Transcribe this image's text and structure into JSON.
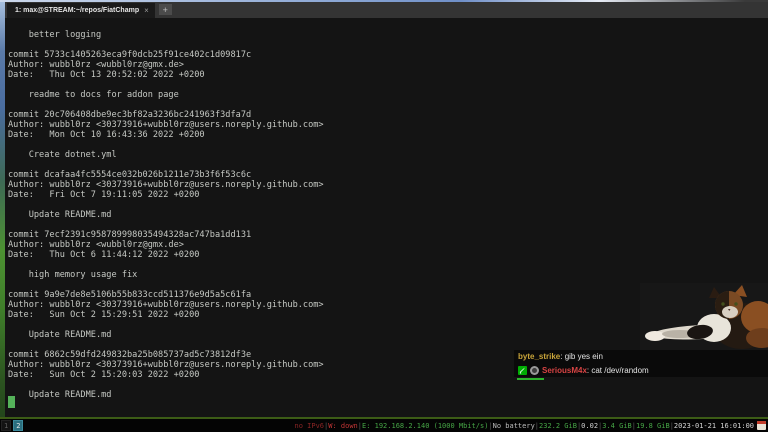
{
  "window": {
    "tab_title": "1: max@STREAM:~/repos/FiatChamp",
    "tab_close": "×",
    "new_tab": "+"
  },
  "terminal": {
    "lines": [
      "    better logging",
      "",
      "commit 5733c1405263eca9f0dcb25f91ce402c1d09817c",
      "Author: wubbl0rz <wubbl0rz@gmx.de>",
      "Date:   Thu Oct 13 20:52:02 2022 +0200",
      "",
      "    readme to docs for addon page",
      "",
      "commit 20c706408dbe9ec3bf82a3236bc241963f3dfa7d",
      "Author: wubbl0rz <30373916+wubbl0rz@users.noreply.github.com>",
      "Date:   Mon Oct 10 16:43:36 2022 +0200",
      "",
      "    Create dotnet.yml",
      "",
      "commit dcafaa4fc5554ce032b026b1211e73b3f6f53c6c",
      "Author: wubbl0rz <30373916+wubbl0rz@users.noreply.github.com>",
      "Date:   Fri Oct 7 19:11:05 2022 +0200",
      "",
      "    Update README.md",
      "",
      "commit 7ecf2391c958789998035494328ac747ba1dd131",
      "Author: wubbl0rz <wubbl0rz@gmx.de>",
      "Date:   Thu Oct 6 11:44:12 2022 +0200",
      "",
      "    high memory usage fix",
      "",
      "commit 9a9e7de8e5106b55b833ccd511376e9d5a5c61fa",
      "Author: wubbl0rz <30373916+wubbl0rz@users.noreply.github.com>",
      "Date:   Sun Oct 2 15:29:51 2022 +0200",
      "",
      "    Update README.md",
      "",
      "commit 6862c59dfd249832ba25b085737ad5c73812df3e",
      "Author: wubbl0rz <30373916+wubbl0rz@users.noreply.github.com>",
      "Date:   Sun Oct 2 15:20:03 2022 +0200",
      "",
      "    Update README.md"
    ],
    "cursor_color": "#55b25a"
  },
  "chat": {
    "messages": [
      {
        "username": "byte_strike",
        "colon": ": ",
        "text": "gib yes ein",
        "username_color": "#c9a53a",
        "badges": []
      },
      {
        "username": "SeriousM4x",
        "colon": ": ",
        "text": "cat /dev/random",
        "username_color": "#d84444",
        "badges": [
          "moderator-badge",
          "gray-badge"
        ]
      }
    ],
    "progress_color": "#2db52d"
  },
  "webcam": {
    "description": "calico cat lying down with front paw stretched out"
  },
  "statusbar": {
    "workspaces": [
      {
        "label": "1",
        "active": false
      },
      {
        "label": "2",
        "active": true
      }
    ],
    "separator": "|",
    "segments": [
      {
        "text": "no IPv6",
        "color": "#8a2525"
      },
      {
        "text": "W: down",
        "color": "#c03535"
      },
      {
        "text": "E: 192.168.2.140 (1000 Mbit/s)",
        "color": "#46a546"
      },
      {
        "text": "No battery",
        "color": "#bdbdbd"
      },
      {
        "text": "232.2 GiB",
        "color": "#46a546"
      },
      {
        "text": "0.02",
        "color": "#cfcfcf"
      },
      {
        "text": "3.4 GiB",
        "color": "#46a546"
      },
      {
        "text": "19.8 GiB",
        "color": "#46a546"
      },
      {
        "text": "2023-01-21 16:01:00",
        "color": "#d5d5d5"
      }
    ]
  },
  "colors": {
    "terminal_bg": "#141414",
    "terminal_text": "#c6c9c4",
    "workspace_active_bg": "#2b6e7e"
  }
}
